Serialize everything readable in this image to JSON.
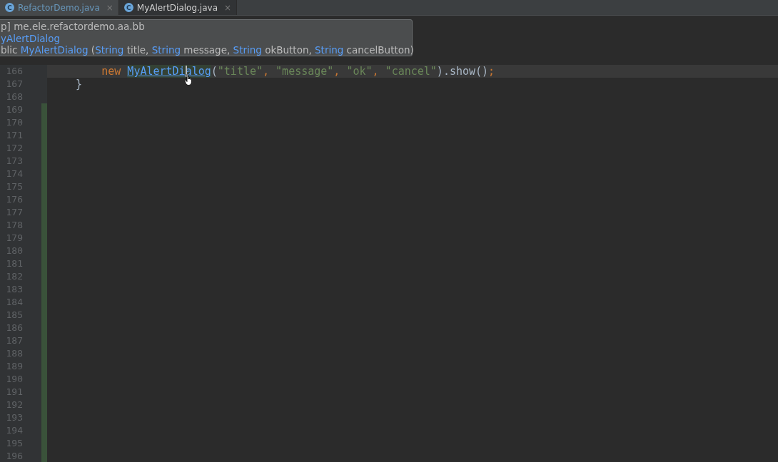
{
  "tabs": [
    {
      "icon_letter": "C",
      "label": "RefactorDemo.java",
      "close": "×",
      "modified": true,
      "selected": false
    },
    {
      "icon_letter": "C",
      "label": "MyAlertDialog.java",
      "close": "×",
      "modified": false,
      "selected": true
    }
  ],
  "tooltip": {
    "package": "p] me.ele.refactordemo.aa.bb",
    "class_name": "yAlertDialog",
    "signature": [
      {
        "kind": "text",
        "text": "blic "
      },
      {
        "kind": "link",
        "text": "MyAlertDialog"
      },
      {
        "kind": "text",
        "text": " ("
      },
      {
        "kind": "link",
        "text": "String"
      },
      {
        "kind": "text",
        "text": " title, "
      },
      {
        "kind": "link",
        "text": "String"
      },
      {
        "kind": "text",
        "text": " message, "
      },
      {
        "kind": "link",
        "text": "String"
      },
      {
        "kind": "text",
        "text": " okButton, "
      },
      {
        "kind": "link",
        "text": "String"
      },
      {
        "kind": "text",
        "text": " cancelButton)"
      }
    ]
  },
  "lines": [
    {
      "number": "166",
      "kind": "statement",
      "current": true,
      "changed": false,
      "tokens": [
        {
          "kind": "keyword",
          "text": "new "
        },
        {
          "kind": "link",
          "text": "MyAlertDialog"
        },
        {
          "kind": "plain",
          "text": "("
        },
        {
          "kind": "string",
          "text": "\"title\""
        },
        {
          "kind": "keyword",
          "text": ", "
        },
        {
          "kind": "string",
          "text": "\"message\""
        },
        {
          "kind": "keyword",
          "text": ", "
        },
        {
          "kind": "string",
          "text": "\"ok\""
        },
        {
          "kind": "keyword",
          "text": ", "
        },
        {
          "kind": "string",
          "text": "\"cancel\""
        },
        {
          "kind": "plain",
          "text": ").show()"
        },
        {
          "kind": "keyword",
          "text": ";"
        }
      ]
    },
    {
      "number": "167",
      "kind": "brace",
      "current": false,
      "changed": false,
      "tokens": [
        {
          "kind": "plain",
          "text": "}"
        }
      ]
    },
    {
      "number": "168",
      "current": false,
      "changed": false
    },
    {
      "number": "169",
      "current": false,
      "changed": true
    },
    {
      "number": "170",
      "current": false,
      "changed": true
    },
    {
      "number": "171",
      "current": false,
      "changed": true
    },
    {
      "number": "172",
      "current": false,
      "changed": true
    },
    {
      "number": "173",
      "current": false,
      "changed": true
    },
    {
      "number": "174",
      "current": false,
      "changed": true
    },
    {
      "number": "175",
      "current": false,
      "changed": true
    },
    {
      "number": "176",
      "current": false,
      "changed": true
    },
    {
      "number": "177",
      "current": false,
      "changed": true
    },
    {
      "number": "178",
      "current": false,
      "changed": true
    },
    {
      "number": "179",
      "current": false,
      "changed": true
    },
    {
      "number": "180",
      "current": false,
      "changed": true
    },
    {
      "number": "181",
      "current": false,
      "changed": true
    },
    {
      "number": "182",
      "current": false,
      "changed": true
    },
    {
      "number": "183",
      "current": false,
      "changed": true
    },
    {
      "number": "184",
      "current": false,
      "changed": true
    },
    {
      "number": "185",
      "current": false,
      "changed": true
    },
    {
      "number": "186",
      "current": false,
      "changed": true
    },
    {
      "number": "187",
      "current": false,
      "changed": true
    },
    {
      "number": "188",
      "current": false,
      "changed": true
    },
    {
      "number": "189",
      "current": false,
      "changed": true
    },
    {
      "number": "190",
      "current": false,
      "changed": true
    },
    {
      "number": "191",
      "current": false,
      "changed": true
    },
    {
      "number": "192",
      "current": false,
      "changed": true
    },
    {
      "number": "193",
      "current": false,
      "changed": true
    },
    {
      "number": "194",
      "current": false,
      "changed": true
    },
    {
      "number": "195",
      "current": false,
      "changed": true
    },
    {
      "number": "196",
      "current": false,
      "changed": true
    }
  ]
}
